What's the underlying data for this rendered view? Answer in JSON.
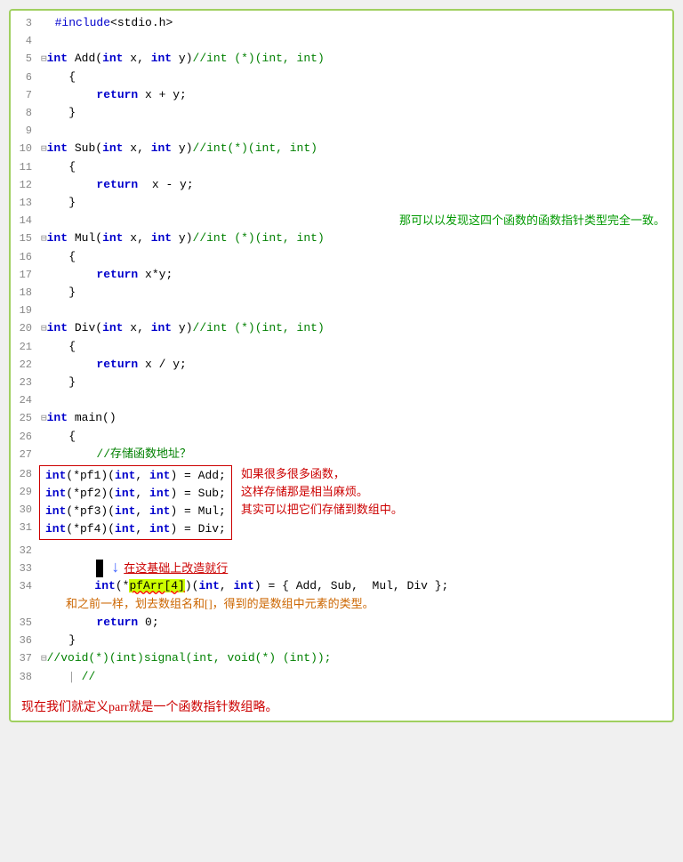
{
  "lines": [
    {
      "num": "3",
      "content": "  #include<stdio.h>",
      "type": "normal"
    },
    {
      "num": "4",
      "content": "",
      "type": "normal"
    },
    {
      "num": "5",
      "content": "",
      "type": "func_add"
    },
    {
      "num": "6",
      "content": "    {",
      "type": "normal"
    },
    {
      "num": "7",
      "content": "        return x + y;",
      "type": "normal"
    },
    {
      "num": "8",
      "content": "    }",
      "type": "normal"
    },
    {
      "num": "9",
      "content": "",
      "type": "normal"
    },
    {
      "num": "10",
      "content": "",
      "type": "func_sub"
    },
    {
      "num": "11",
      "content": "    {",
      "type": "normal"
    },
    {
      "num": "12",
      "content": "        return  x - y;",
      "type": "normal"
    },
    {
      "num": "13",
      "content": "    }",
      "type": "normal"
    },
    {
      "num": "14",
      "content": "",
      "type": "with_annotation"
    },
    {
      "num": "15",
      "content": "",
      "type": "func_mul"
    },
    {
      "num": "16",
      "content": "    {",
      "type": "normal"
    },
    {
      "num": "17",
      "content": "        return x*y;",
      "type": "normal"
    },
    {
      "num": "18",
      "content": "    }",
      "type": "normal"
    },
    {
      "num": "19",
      "content": "",
      "type": "normal"
    },
    {
      "num": "20",
      "content": "",
      "type": "func_div"
    },
    {
      "num": "21",
      "content": "    {",
      "type": "normal"
    },
    {
      "num": "22",
      "content": "        return x / y;",
      "type": "normal"
    },
    {
      "num": "23",
      "content": "    }",
      "type": "normal"
    },
    {
      "num": "24",
      "content": "",
      "type": "normal"
    },
    {
      "num": "25",
      "content": "",
      "type": "func_main"
    },
    {
      "num": "26",
      "content": "    {",
      "type": "normal"
    },
    {
      "num": "27",
      "content": "        //存储函数地址？",
      "type": "comment_cn"
    },
    {
      "num": "28",
      "content": "red_box_start"
    },
    {
      "num": "29",
      "content": "red_box_mid"
    },
    {
      "num": "30",
      "content": "red_box_mid2"
    },
    {
      "num": "31",
      "content": "red_box_end"
    },
    {
      "num": "32",
      "content": "",
      "type": "normal"
    },
    {
      "num": "33",
      "content": "        ",
      "type": "arrow_line"
    },
    {
      "num": "34",
      "content": "",
      "type": "arr_line"
    },
    {
      "num": "35",
      "content": "        return 0;",
      "type": "normal"
    },
    {
      "num": "36",
      "content": "    }",
      "type": "normal"
    },
    {
      "num": "37",
      "content": "",
      "type": "line37"
    },
    {
      "num": "38",
      "content": "    //",
      "type": "normal"
    }
  ],
  "bottom_text": "现在我们就定义parr就是一个函数指针数组略。",
  "annotations": {
    "line14": "那可以以发现这四个函数的函数指针类型完全一致。",
    "red_right1": "如果很多很多函数，",
    "red_right2": "这样存储那是相当麻烦。",
    "red_right3": "其实可以把它们存储到数组中。",
    "line33_text": "在这基础上改造就行",
    "line34_annotation": "和之前一样，划去数组名和[]，得到的是数组中元素的类型。"
  }
}
